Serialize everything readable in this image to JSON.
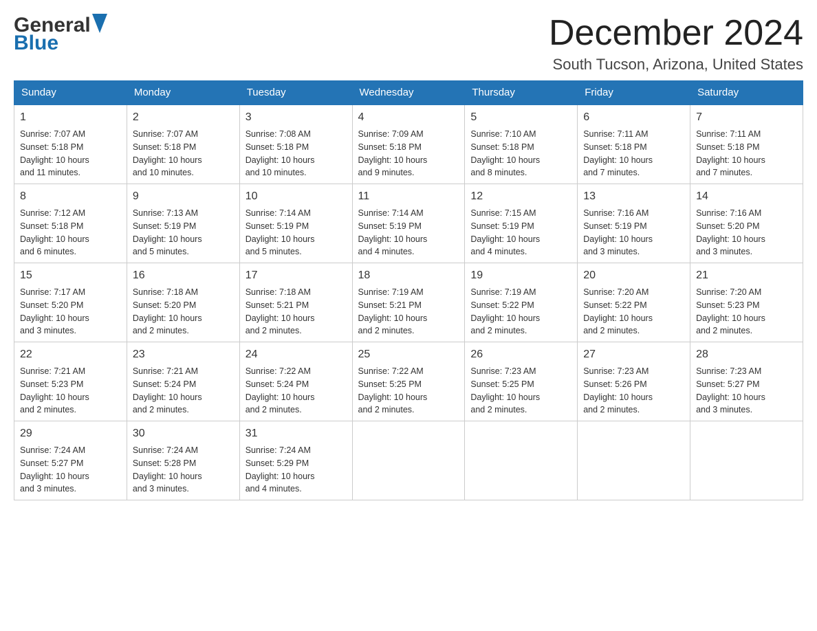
{
  "logo": {
    "general": "General",
    "blue": "Blue",
    "arrow_color": "#1a6faf"
  },
  "header": {
    "month": "December 2024",
    "location": "South Tucson, Arizona, United States"
  },
  "days_of_week": [
    "Sunday",
    "Monday",
    "Tuesday",
    "Wednesday",
    "Thursday",
    "Friday",
    "Saturday"
  ],
  "weeks": [
    [
      {
        "day": "1",
        "sunrise": "7:07 AM",
        "sunset": "5:18 PM",
        "daylight": "10 hours and 11 minutes."
      },
      {
        "day": "2",
        "sunrise": "7:07 AM",
        "sunset": "5:18 PM",
        "daylight": "10 hours and 10 minutes."
      },
      {
        "day": "3",
        "sunrise": "7:08 AM",
        "sunset": "5:18 PM",
        "daylight": "10 hours and 10 minutes."
      },
      {
        "day": "4",
        "sunrise": "7:09 AM",
        "sunset": "5:18 PM",
        "daylight": "10 hours and 9 minutes."
      },
      {
        "day": "5",
        "sunrise": "7:10 AM",
        "sunset": "5:18 PM",
        "daylight": "10 hours and 8 minutes."
      },
      {
        "day": "6",
        "sunrise": "7:11 AM",
        "sunset": "5:18 PM",
        "daylight": "10 hours and 7 minutes."
      },
      {
        "day": "7",
        "sunrise": "7:11 AM",
        "sunset": "5:18 PM",
        "daylight": "10 hours and 7 minutes."
      }
    ],
    [
      {
        "day": "8",
        "sunrise": "7:12 AM",
        "sunset": "5:18 PM",
        "daylight": "10 hours and 6 minutes."
      },
      {
        "day": "9",
        "sunrise": "7:13 AM",
        "sunset": "5:19 PM",
        "daylight": "10 hours and 5 minutes."
      },
      {
        "day": "10",
        "sunrise": "7:14 AM",
        "sunset": "5:19 PM",
        "daylight": "10 hours and 5 minutes."
      },
      {
        "day": "11",
        "sunrise": "7:14 AM",
        "sunset": "5:19 PM",
        "daylight": "10 hours and 4 minutes."
      },
      {
        "day": "12",
        "sunrise": "7:15 AM",
        "sunset": "5:19 PM",
        "daylight": "10 hours and 4 minutes."
      },
      {
        "day": "13",
        "sunrise": "7:16 AM",
        "sunset": "5:19 PM",
        "daylight": "10 hours and 3 minutes."
      },
      {
        "day": "14",
        "sunrise": "7:16 AM",
        "sunset": "5:20 PM",
        "daylight": "10 hours and 3 minutes."
      }
    ],
    [
      {
        "day": "15",
        "sunrise": "7:17 AM",
        "sunset": "5:20 PM",
        "daylight": "10 hours and 3 minutes."
      },
      {
        "day": "16",
        "sunrise": "7:18 AM",
        "sunset": "5:20 PM",
        "daylight": "10 hours and 2 minutes."
      },
      {
        "day": "17",
        "sunrise": "7:18 AM",
        "sunset": "5:21 PM",
        "daylight": "10 hours and 2 minutes."
      },
      {
        "day": "18",
        "sunrise": "7:19 AM",
        "sunset": "5:21 PM",
        "daylight": "10 hours and 2 minutes."
      },
      {
        "day": "19",
        "sunrise": "7:19 AM",
        "sunset": "5:22 PM",
        "daylight": "10 hours and 2 minutes."
      },
      {
        "day": "20",
        "sunrise": "7:20 AM",
        "sunset": "5:22 PM",
        "daylight": "10 hours and 2 minutes."
      },
      {
        "day": "21",
        "sunrise": "7:20 AM",
        "sunset": "5:23 PM",
        "daylight": "10 hours and 2 minutes."
      }
    ],
    [
      {
        "day": "22",
        "sunrise": "7:21 AM",
        "sunset": "5:23 PM",
        "daylight": "10 hours and 2 minutes."
      },
      {
        "day": "23",
        "sunrise": "7:21 AM",
        "sunset": "5:24 PM",
        "daylight": "10 hours and 2 minutes."
      },
      {
        "day": "24",
        "sunrise": "7:22 AM",
        "sunset": "5:24 PM",
        "daylight": "10 hours and 2 minutes."
      },
      {
        "day": "25",
        "sunrise": "7:22 AM",
        "sunset": "5:25 PM",
        "daylight": "10 hours and 2 minutes."
      },
      {
        "day": "26",
        "sunrise": "7:23 AM",
        "sunset": "5:25 PM",
        "daylight": "10 hours and 2 minutes."
      },
      {
        "day": "27",
        "sunrise": "7:23 AM",
        "sunset": "5:26 PM",
        "daylight": "10 hours and 2 minutes."
      },
      {
        "day": "28",
        "sunrise": "7:23 AM",
        "sunset": "5:27 PM",
        "daylight": "10 hours and 3 minutes."
      }
    ],
    [
      {
        "day": "29",
        "sunrise": "7:24 AM",
        "sunset": "5:27 PM",
        "daylight": "10 hours and 3 minutes."
      },
      {
        "day": "30",
        "sunrise": "7:24 AM",
        "sunset": "5:28 PM",
        "daylight": "10 hours and 3 minutes."
      },
      {
        "day": "31",
        "sunrise": "7:24 AM",
        "sunset": "5:29 PM",
        "daylight": "10 hours and 4 minutes."
      },
      null,
      null,
      null,
      null
    ]
  ],
  "labels": {
    "sunrise": "Sunrise:",
    "sunset": "Sunset:",
    "daylight": "Daylight:"
  }
}
